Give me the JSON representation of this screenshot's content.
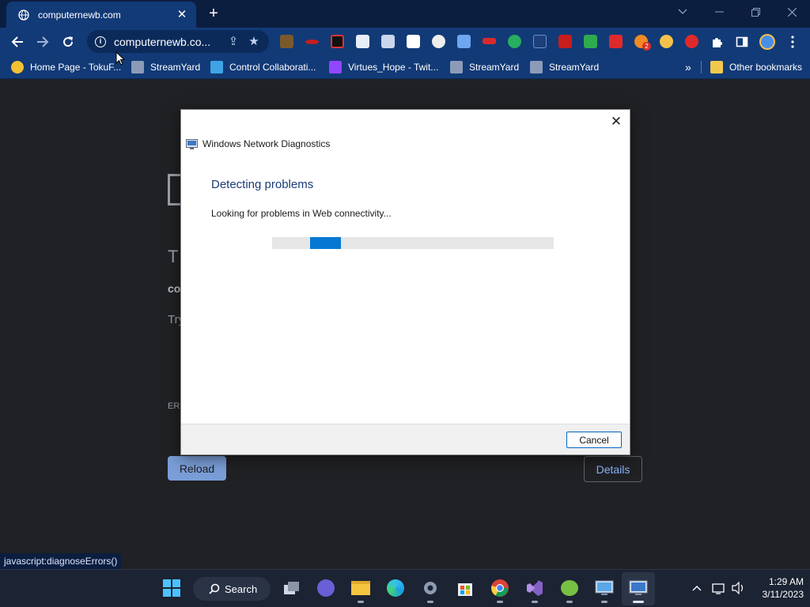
{
  "browser": {
    "tab": {
      "title": "computernewb.com",
      "close": "✕"
    },
    "omnibox": {
      "url": "computernewb.co..."
    },
    "bookmarks": [
      {
        "label": "Home Page - TokuF..."
      },
      {
        "label": "StreamYard"
      },
      {
        "label": "Control Collaborati..."
      },
      {
        "label": "Virtues_Hope - Twit..."
      },
      {
        "label": "StreamYard"
      },
      {
        "label": "StreamYard"
      }
    ],
    "bookmarks_overflow": "»",
    "other_bookmarks": "Other bookmarks",
    "extension_badge": "2",
    "status_text": "javascript:diagnoseErrors()"
  },
  "page_behind": {
    "fragments": [
      "T",
      "co",
      "Try",
      "ERI"
    ],
    "reload_label": "Reload",
    "details_label": "Details"
  },
  "dialog": {
    "title": "Windows Network Diagnostics",
    "heading": "Detecting problems",
    "message": "Looking for problems in Web connectivity...",
    "progress_fraction": 0.11,
    "cancel_label": "Cancel"
  },
  "taskbar": {
    "search_label": "Search",
    "time": "1:29 AM",
    "date": "3/11/2023"
  },
  "colors": {
    "tabstrip": "#0b1e3f",
    "toolbar": "#123a77",
    "progress": "#0678d4",
    "page_bg": "#202124"
  }
}
